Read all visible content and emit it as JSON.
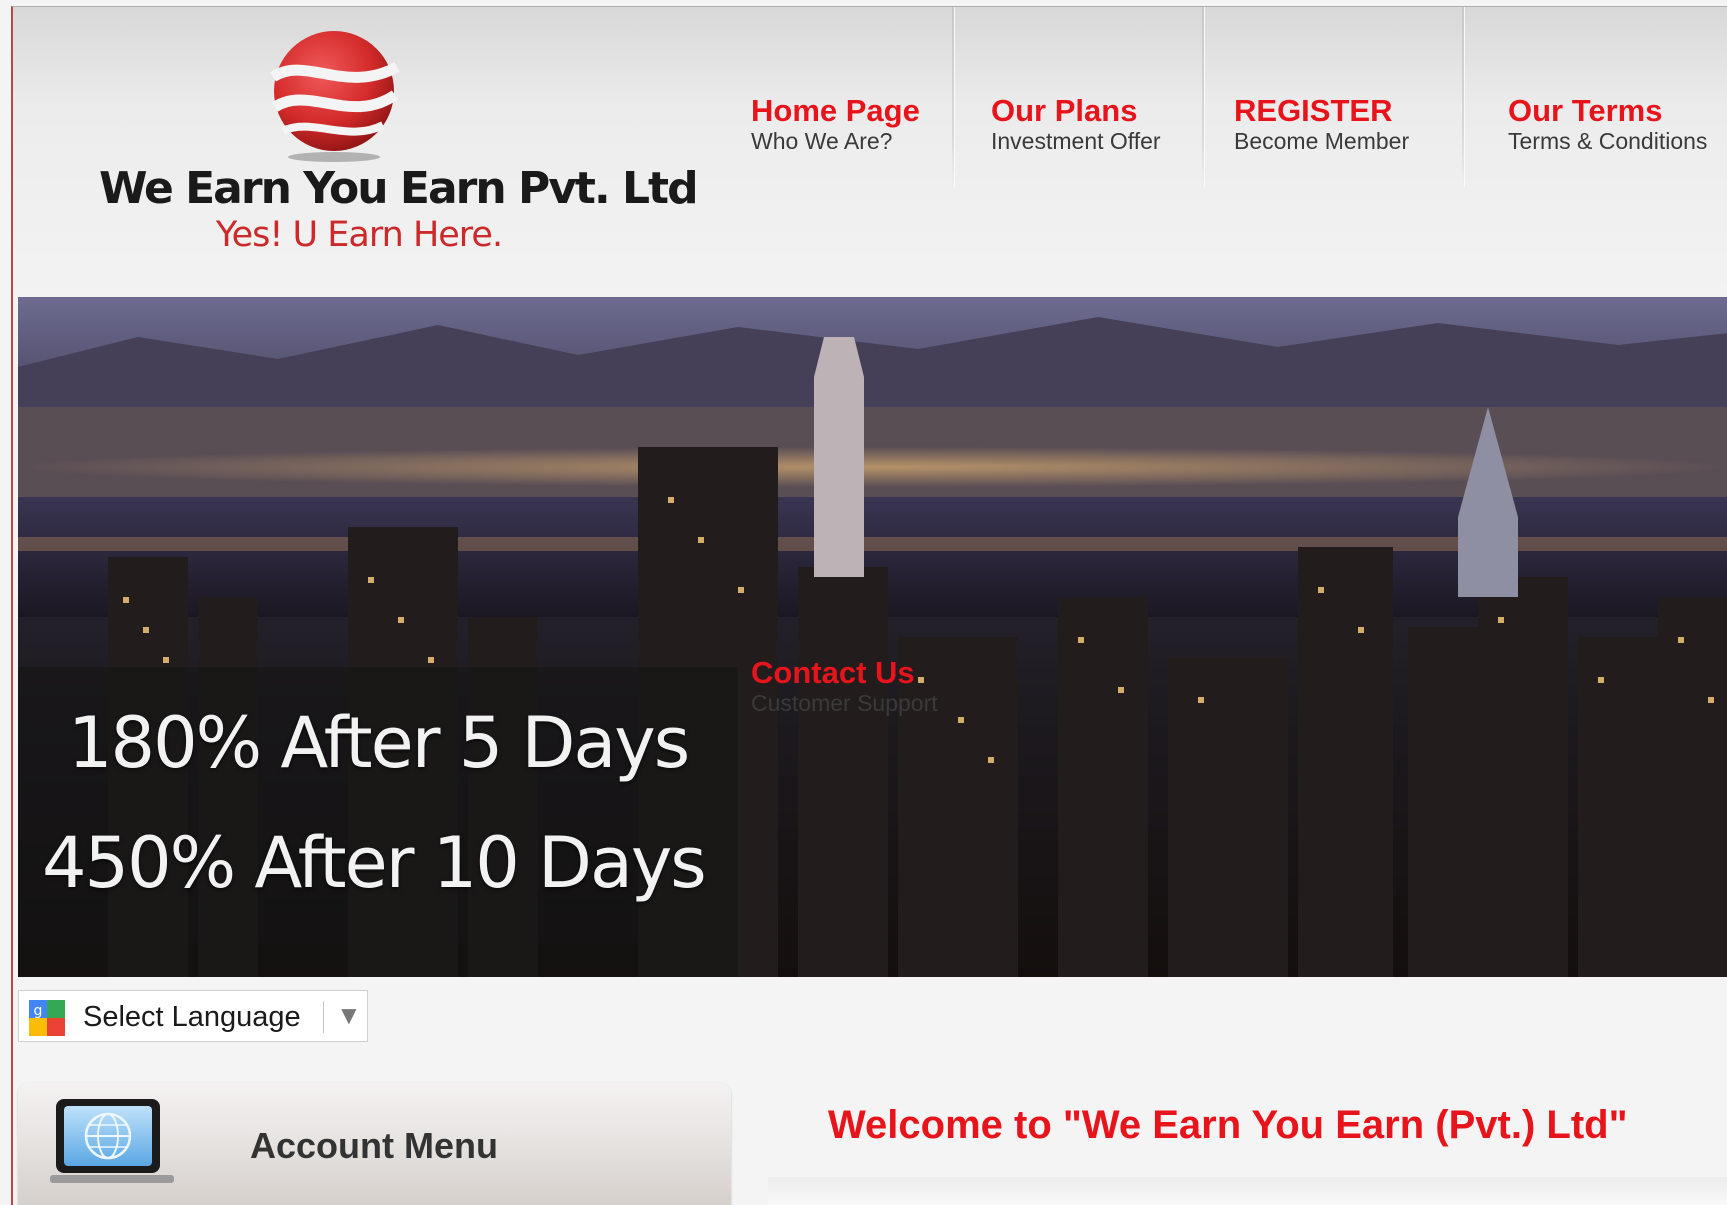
{
  "site": {
    "name": "We Earn You Earn Pvt. Ltd",
    "tagline": "Yes! U Earn Here."
  },
  "nav": {
    "items": [
      {
        "title": "Home Page",
        "subtitle": "Who We Are?"
      },
      {
        "title": "Our Plans",
        "subtitle": "Investment Offer"
      },
      {
        "title": "REGISTER",
        "subtitle": "Become Member"
      },
      {
        "title": "Our Terms",
        "subtitle": "Terms & Conditions"
      },
      {
        "title": "Contact Us",
        "subtitle": "Customer Support"
      }
    ]
  },
  "banner": {
    "line1": "180% After 5 Days",
    "line2": "450% After 10 Days"
  },
  "language": {
    "label": "Select Language"
  },
  "sidebar": {
    "account_menu_label": "Account Menu"
  },
  "main": {
    "welcome": "Welcome to \"We Earn You Earn (Pvt.) Ltd\""
  },
  "colors": {
    "accent": "#e8141b",
    "text": "#3a3a3a"
  },
  "icons": {
    "logo": "swirl-sphere-logo",
    "language": "google-translate-icon",
    "account": "monitor-globe-icon"
  }
}
